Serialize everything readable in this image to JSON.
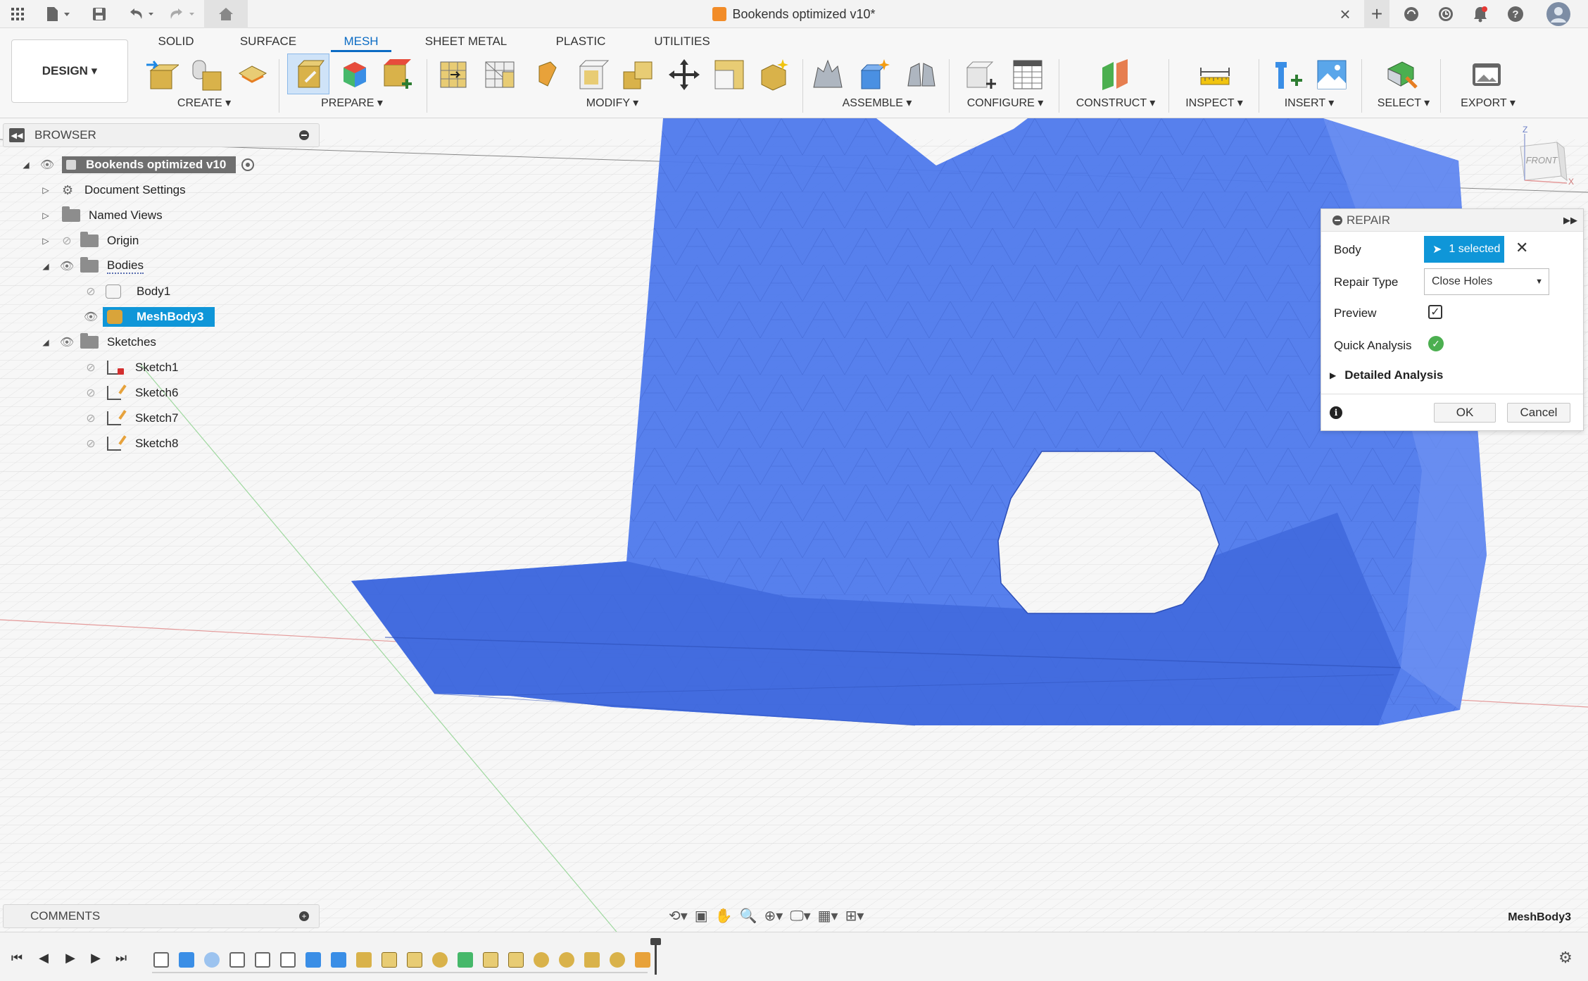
{
  "title_bar": {
    "document_title": "Bookends optimized v10*",
    "icons": [
      "grid-icon",
      "file-icon",
      "save-icon",
      "undo-icon",
      "redo-icon",
      "home-icon",
      "close-tab-icon",
      "new-tab-icon",
      "extensions-icon",
      "job-status-icon",
      "notifications-icon",
      "help-icon",
      "profile-icon"
    ]
  },
  "ribbon": {
    "workspace_button": "DESIGN ▾",
    "tabs": [
      {
        "label": "SOLID"
      },
      {
        "label": "SURFACE"
      },
      {
        "label": "MESH"
      },
      {
        "label": "SHEET METAL"
      },
      {
        "label": "PLASTIC"
      },
      {
        "label": "UTILITIES"
      }
    ],
    "active_tab": "MESH",
    "groups": [
      {
        "label": "CREATE ▾"
      },
      {
        "label": "PREPARE ▾"
      },
      {
        "label": "MODIFY ▾"
      },
      {
        "label": "ASSEMBLE ▾"
      },
      {
        "label": "CONFIGURE ▾"
      },
      {
        "label": "CONSTRUCT ▾"
      },
      {
        "label": "INSPECT ▾"
      },
      {
        "label": "INSERT ▾"
      },
      {
        "label": "SELECT ▾"
      },
      {
        "label": "EXPORT ▾"
      }
    ]
  },
  "browser": {
    "header": "BROWSER",
    "items": [
      {
        "label": "Bookends optimized v10",
        "level": 0
      },
      {
        "label": "Document Settings",
        "level": 1
      },
      {
        "label": "Named Views",
        "level": 1
      },
      {
        "label": "Origin",
        "level": 1
      },
      {
        "label": "Bodies",
        "level": 1
      },
      {
        "label": "Body1",
        "level": 2
      },
      {
        "label": "MeshBody3",
        "level": 2,
        "selected": true
      },
      {
        "label": "Sketches",
        "level": 1
      },
      {
        "label": "Sketch1",
        "level": 2
      },
      {
        "label": "Sketch6",
        "level": 2
      },
      {
        "label": "Sketch7",
        "level": 2
      },
      {
        "label": "Sketch8",
        "level": 2
      }
    ]
  },
  "repair": {
    "header": "REPAIR",
    "body_label": "Body",
    "body_value": "1 selected",
    "repair_type_label": "Repair Type",
    "repair_type_value": "Close Holes",
    "preview_label": "Preview",
    "preview_checked": true,
    "quick_analysis_label": "Quick Analysis",
    "detailed_analysis_label": "Detailed Analysis",
    "ok_label": "OK",
    "cancel_label": "Cancel"
  },
  "viewcube": {
    "face_label": "FRONT",
    "axis_z": "Z",
    "axis_x": "X"
  },
  "comments": {
    "header": "COMMENTS"
  },
  "status": {
    "selected_name": "MeshBody3"
  },
  "colors": {
    "accent": "#0a6bc4",
    "selection_blue": "#0f96d8",
    "mesh_blue": "#4e79ec",
    "mesh_blue_dark": "#3d63d6"
  }
}
